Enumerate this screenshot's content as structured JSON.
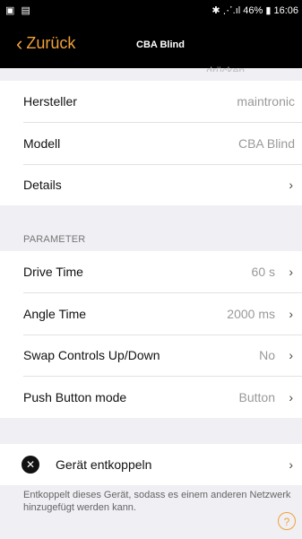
{
  "status_bar": {
    "left_icons": "▣ ▤",
    "right_text": "✱ ⋰.ıl 46% ▮ 16:06"
  },
  "nav": {
    "back_label": "Zurück",
    "title": "CBA Blind"
  },
  "ghost_text": "drücken",
  "device_info": [
    {
      "label": "Hersteller",
      "value": "maintronic"
    },
    {
      "label": "Modell",
      "value": "CBA Blind"
    },
    {
      "label": "Details",
      "value": ""
    }
  ],
  "parameter_section": {
    "title": "PARAMETER",
    "items": [
      {
        "label": "Drive Time",
        "value": "60 s"
      },
      {
        "label": "Angle Time",
        "value": "2000 ms"
      },
      {
        "label": "Swap Controls Up/Down",
        "value": "No"
      },
      {
        "label": "Push Button mode",
        "value": "Button"
      }
    ]
  },
  "unpair": {
    "label": "Gerät entkoppeln",
    "description": "Entkoppelt dieses Gerät, sodass es einem anderen Netzwerk hinzugefügt werden kann."
  },
  "icons": {
    "back": "chevron-left-icon",
    "row_chevron": "chevron-right-icon",
    "unpair": "close-circle-icon",
    "help": "help-icon"
  },
  "colors": {
    "accent": "#f0a23a",
    "nav_background": "#000000",
    "page_background": "#efeff4"
  }
}
